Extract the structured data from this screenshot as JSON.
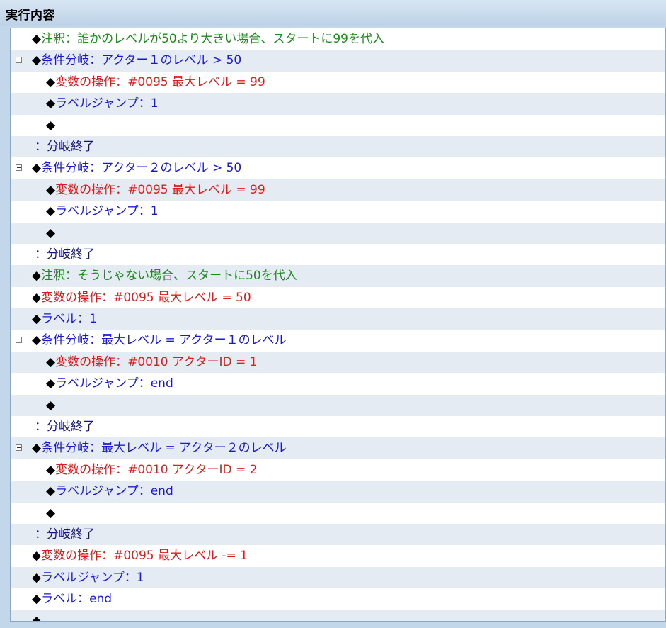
{
  "header": {
    "title": "実行内容"
  },
  "rows": [
    {
      "indent": 0,
      "toggle": false,
      "diamond": "◆",
      "text": "注釈：誰かのレベルが50より大きい場合、スタートに99を代入",
      "color": "#1e8a1e"
    },
    {
      "indent": 0,
      "toggle": true,
      "diamond": "◆",
      "text": "条件分岐：アクター１のレベル > 50",
      "color": "#1818d8"
    },
    {
      "indent": 1,
      "toggle": false,
      "diamond": "◆",
      "text": "変数の操作：#0095 最大レベル = 99",
      "color": "#e01a1a"
    },
    {
      "indent": 1,
      "toggle": false,
      "diamond": "◆",
      "text": "ラベルジャンプ：1",
      "color": "#1818d8"
    },
    {
      "indent": 1,
      "toggle": false,
      "diamond": "◆",
      "text": "",
      "color": "#1818d8"
    },
    {
      "indent": 0,
      "toggle": false,
      "diamond": "",
      "text": "：分岐終了",
      "color": "#121288"
    },
    {
      "indent": 0,
      "toggle": true,
      "diamond": "◆",
      "text": "条件分岐：アクター２のレベル > 50",
      "color": "#1818d8"
    },
    {
      "indent": 1,
      "toggle": false,
      "diamond": "◆",
      "text": "変数の操作：#0095 最大レベル = 99",
      "color": "#e01a1a"
    },
    {
      "indent": 1,
      "toggle": false,
      "diamond": "◆",
      "text": "ラベルジャンプ：1",
      "color": "#1818d8"
    },
    {
      "indent": 1,
      "toggle": false,
      "diamond": "◆",
      "text": "",
      "color": "#1818d8"
    },
    {
      "indent": 0,
      "toggle": false,
      "diamond": "",
      "text": "：分岐終了",
      "color": "#121288"
    },
    {
      "indent": 0,
      "toggle": false,
      "diamond": "◆",
      "text": "注釈：そうじゃない場合、スタートに50を代入",
      "color": "#1e8a1e"
    },
    {
      "indent": 0,
      "toggle": false,
      "diamond": "◆",
      "text": "変数の操作：#0095 最大レベル = 50",
      "color": "#e01a1a"
    },
    {
      "indent": 0,
      "toggle": false,
      "diamond": "◆",
      "text": "ラベル：1",
      "color": "#1818d8"
    },
    {
      "indent": 0,
      "toggle": true,
      "diamond": "◆",
      "text": "条件分岐：最大レベル = アクター１のレベル",
      "color": "#1818d8"
    },
    {
      "indent": 1,
      "toggle": false,
      "diamond": "◆",
      "text": "変数の操作：#0010 アクターID = 1",
      "color": "#e01a1a"
    },
    {
      "indent": 1,
      "toggle": false,
      "diamond": "◆",
      "text": "ラベルジャンプ：end",
      "color": "#1818d8"
    },
    {
      "indent": 1,
      "toggle": false,
      "diamond": "◆",
      "text": "",
      "color": "#1818d8"
    },
    {
      "indent": 0,
      "toggle": false,
      "diamond": "",
      "text": "：分岐終了",
      "color": "#121288"
    },
    {
      "indent": 0,
      "toggle": true,
      "diamond": "◆",
      "text": "条件分岐：最大レベル = アクター２のレベル",
      "color": "#1818d8"
    },
    {
      "indent": 1,
      "toggle": false,
      "diamond": "◆",
      "text": "変数の操作：#0010 アクターID = 2",
      "color": "#e01a1a"
    },
    {
      "indent": 1,
      "toggle": false,
      "diamond": "◆",
      "text": "ラベルジャンプ：end",
      "color": "#1818d8"
    },
    {
      "indent": 1,
      "toggle": false,
      "diamond": "◆",
      "text": "",
      "color": "#1818d8"
    },
    {
      "indent": 0,
      "toggle": false,
      "diamond": "",
      "text": "：分岐終了",
      "color": "#121288"
    },
    {
      "indent": 0,
      "toggle": false,
      "diamond": "◆",
      "text": "変数の操作：#0095 最大レベル -= 1",
      "color": "#e01a1a"
    },
    {
      "indent": 0,
      "toggle": false,
      "diamond": "◆",
      "text": "ラベルジャンプ：1",
      "color": "#1818d8"
    },
    {
      "indent": 0,
      "toggle": false,
      "diamond": "◆",
      "text": "ラベル：end",
      "color": "#1818d8"
    },
    {
      "indent": 0,
      "toggle": false,
      "diamond": "◆",
      "text": "",
      "color": "#1818d8"
    }
  ]
}
